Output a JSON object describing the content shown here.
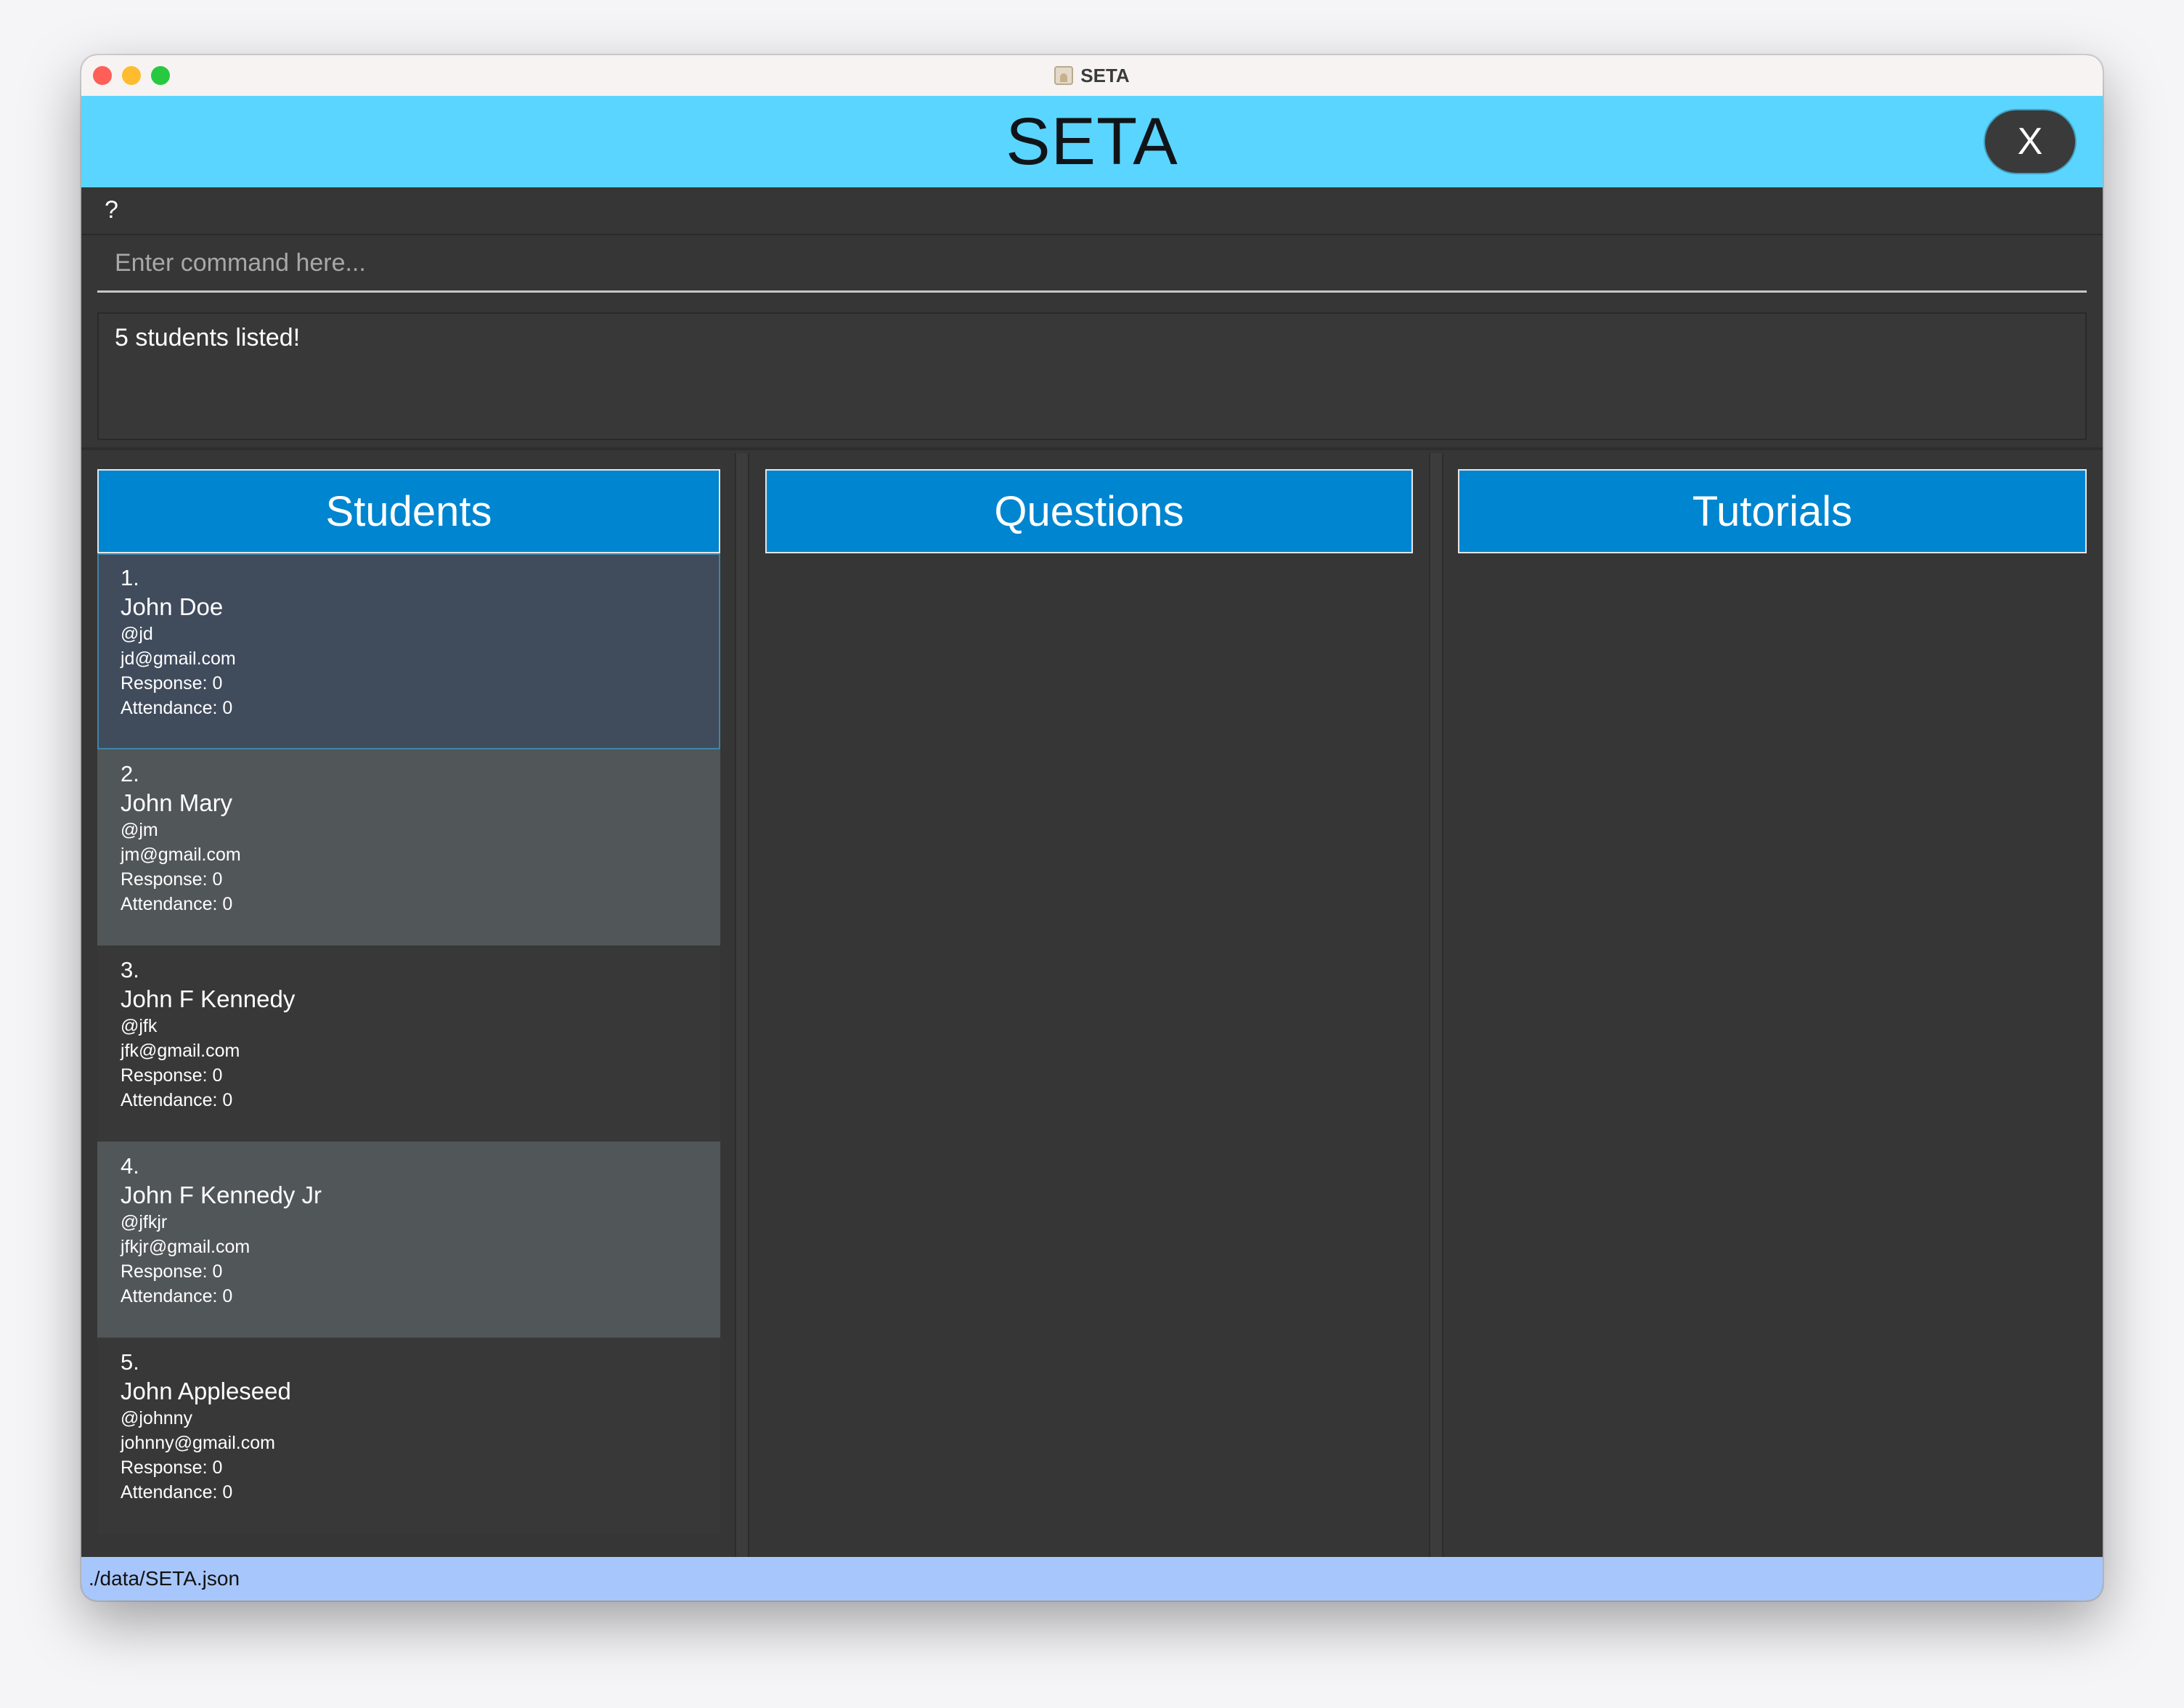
{
  "window": {
    "title": "SETA"
  },
  "header": {
    "title": "SETA",
    "close_label": "X"
  },
  "menu": {
    "help_label": "?"
  },
  "command": {
    "placeholder": "Enter command here...",
    "value": ""
  },
  "result": {
    "text": "5 students listed!"
  },
  "panels": {
    "students": "Students",
    "questions": "Questions",
    "tutorials": "Tutorials"
  },
  "students": [
    {
      "index": "1.",
      "name": "John Doe",
      "telegram": "@jd",
      "email": "jd@gmail.com",
      "response": "Response: 0",
      "attendance": "Attendance: 0"
    },
    {
      "index": "2.",
      "name": "John Mary",
      "telegram": "@jm",
      "email": "jm@gmail.com",
      "response": "Response: 0",
      "attendance": "Attendance: 0"
    },
    {
      "index": "3.",
      "name": "John F Kennedy",
      "telegram": "@jfk",
      "email": "jfk@gmail.com",
      "response": "Response: 0",
      "attendance": "Attendance: 0"
    },
    {
      "index": "4.",
      "name": "John F Kennedy Jr",
      "telegram": "@jfkjr",
      "email": "jfkjr@gmail.com",
      "response": "Response: 0",
      "attendance": "Attendance: 0"
    },
    {
      "index": "5.",
      "name": "John Appleseed",
      "telegram": "@johnny",
      "email": "johnny@gmail.com",
      "response": "Response: 0",
      "attendance": "Attendance: 0"
    }
  ],
  "status": {
    "path": "./data/SETA.json"
  },
  "colors": {
    "header_bg": "#5ad5ff",
    "panel_header_bg": "#0085d0",
    "status_bg": "#a7c6fb",
    "app_bg": "#363636",
    "selected_card_bg": "#404b5c"
  }
}
